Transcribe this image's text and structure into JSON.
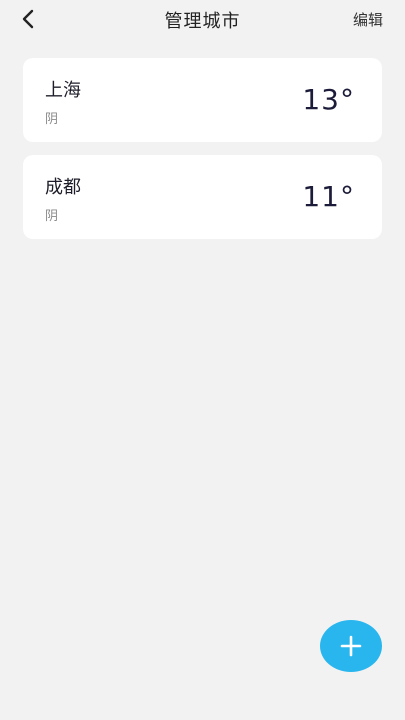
{
  "header": {
    "title": "管理城市",
    "edit_label": "编辑",
    "back_icon": "chevron-left-icon"
  },
  "cities": [
    {
      "name": "上海",
      "weather": "阴",
      "temperature": "13°"
    },
    {
      "name": "成都",
      "weather": "阴",
      "temperature": "11°"
    }
  ],
  "fab": {
    "icon": "plus-icon",
    "color": "#29b6ee"
  },
  "colors": {
    "background": "#f2f2f2",
    "card": "#ffffff",
    "accent": "#29b6ee"
  }
}
